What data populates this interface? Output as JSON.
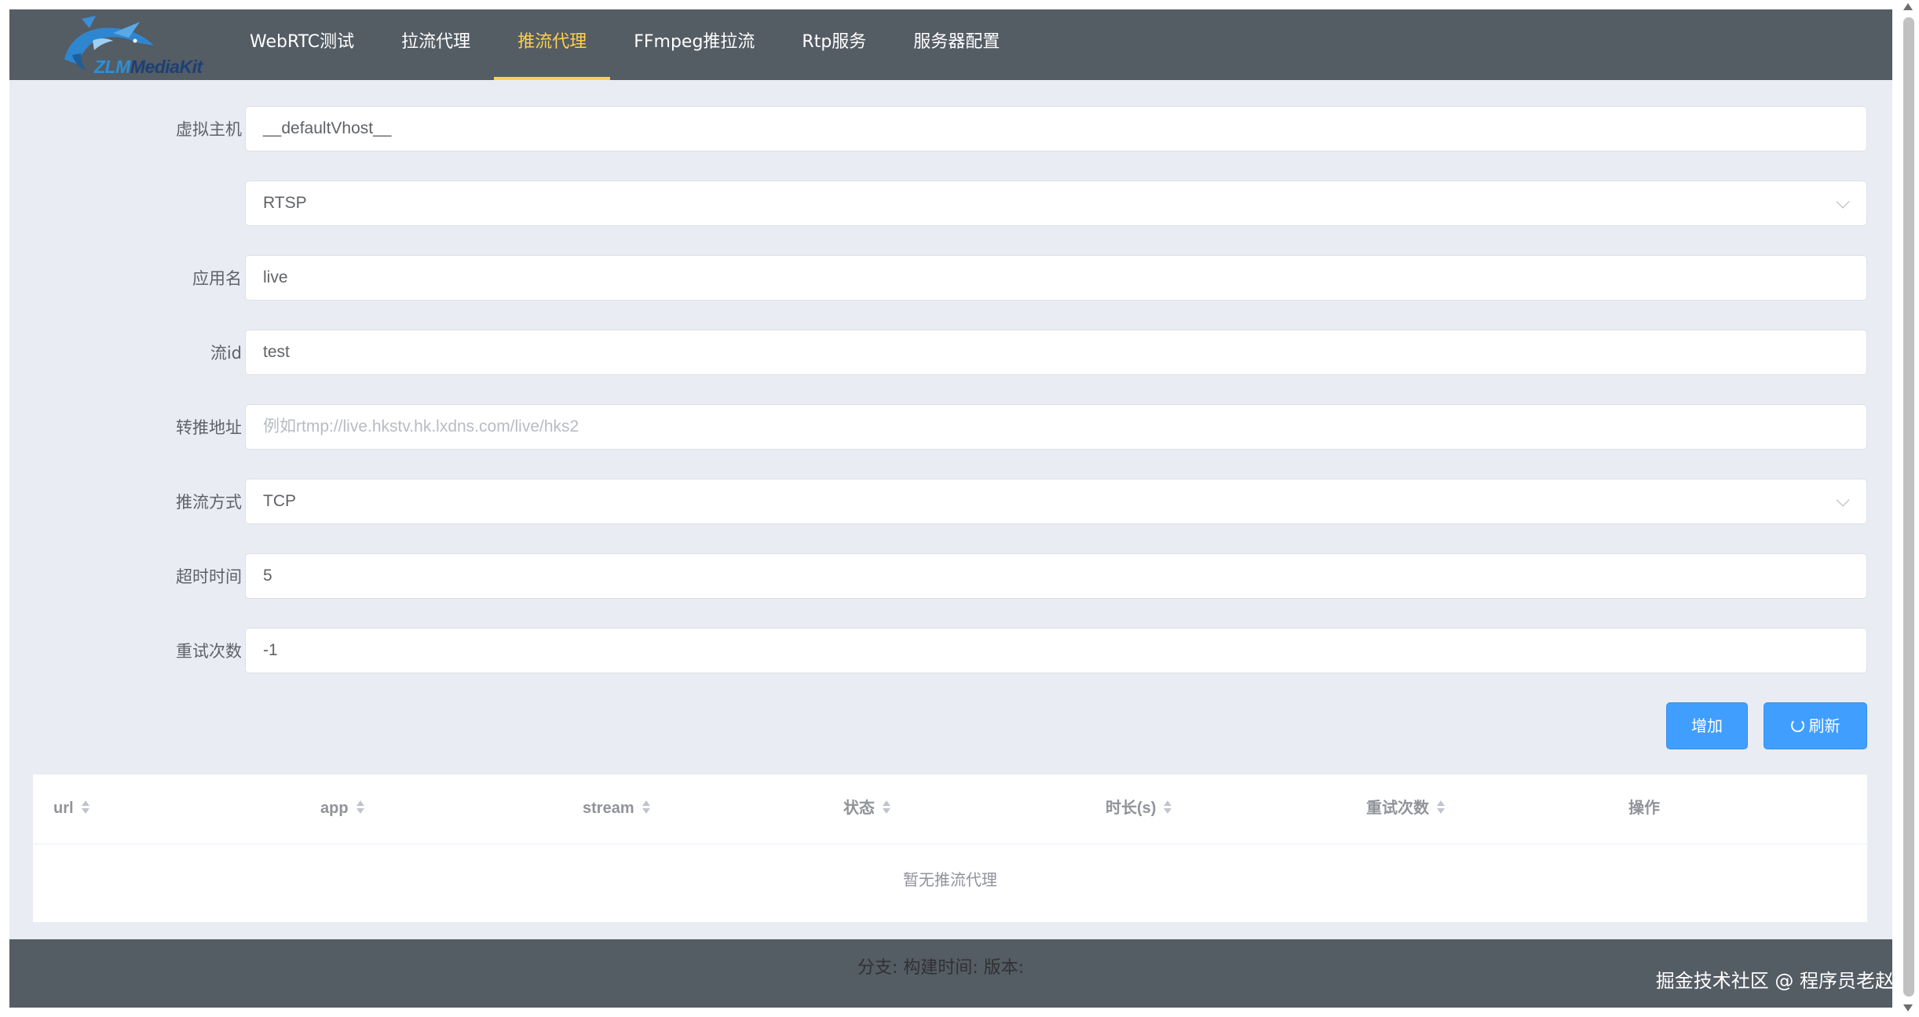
{
  "app": {
    "logo_text_prefix": "ZLM",
    "logo_text_suffix": "ediaKit"
  },
  "nav": {
    "items": [
      {
        "label": "WebRTC测试",
        "active": false
      },
      {
        "label": "拉流代理",
        "active": false
      },
      {
        "label": "推流代理",
        "active": true
      },
      {
        "label": "FFmpeg推拉流",
        "active": false
      },
      {
        "label": "Rtp服务",
        "active": false
      },
      {
        "label": "服务器配置",
        "active": false
      }
    ]
  },
  "form": {
    "vhost": {
      "label": "虚拟主机",
      "value": "__defaultVhost__"
    },
    "schema": {
      "label": "",
      "value": "RTSP"
    },
    "app": {
      "label": "应用名",
      "value": "live"
    },
    "stream": {
      "label": "流id",
      "value": "test"
    },
    "dst_url": {
      "label": "转推地址",
      "value": "",
      "placeholder": "例如rtmp://live.hkstv.hk.lxdns.com/live/hks2"
    },
    "rtp_type": {
      "label": "推流方式",
      "value": "TCP"
    },
    "timeout": {
      "label": "超时时间",
      "value": "5"
    },
    "retry": {
      "label": "重试次数",
      "value": "-1"
    }
  },
  "buttons": {
    "add": "增加",
    "refresh": "刷新"
  },
  "table": {
    "columns": [
      "url",
      "app",
      "stream",
      "状态",
      "时长(s)",
      "重试次数",
      "操作"
    ],
    "empty_text": "暂无推流代理"
  },
  "footer": {
    "text": "分支:   构建时间: 版本:"
  },
  "credit": "掘金技术社区 @ 程序员老赵",
  "colors": {
    "header_bg": "#545c64",
    "active_nav": "#ffd04b",
    "primary": "#409eff",
    "page_bg": "#e9edf3"
  }
}
